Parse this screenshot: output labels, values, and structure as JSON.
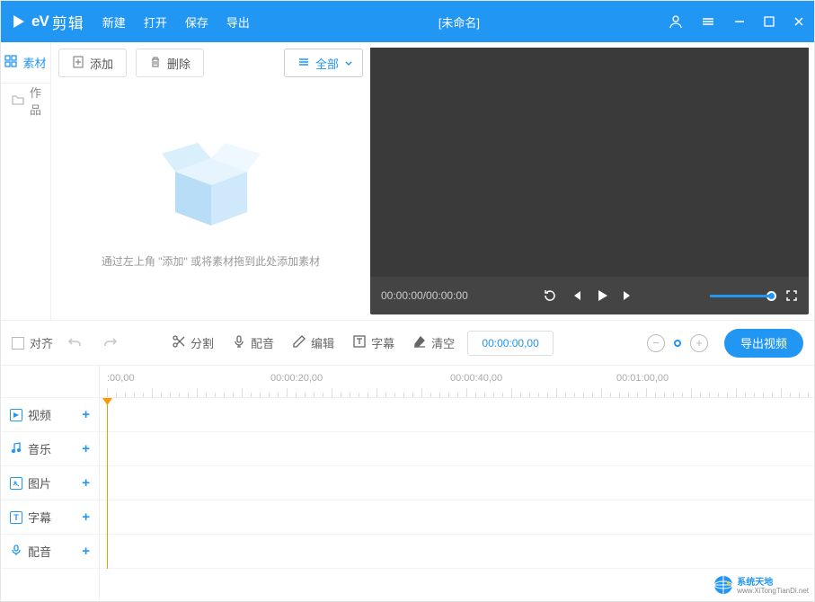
{
  "titlebar": {
    "app_name": "剪辑",
    "menu": {
      "new": "新建",
      "open": "打开",
      "save": "保存",
      "export": "导出"
    },
    "document_title": "[未命名]"
  },
  "sidebar": {
    "tab_material": "素材",
    "tab_works": "作品"
  },
  "material": {
    "add_label": "添加",
    "delete_label": "删除",
    "filter_all": "全部",
    "empty_hint": "通过左上角 \"添加\" 或将素材拖到此处添加素材"
  },
  "preview": {
    "time_display": "00:00:00/00:00:00"
  },
  "edit_toolbar": {
    "align": "对齐",
    "split": "分割",
    "voiceover": "配音",
    "edit": "编辑",
    "subtitle": "字幕",
    "clear": "清空",
    "timecode": "00:00:00,00",
    "export_video": "导出视频"
  },
  "ruler_marks": [
    {
      "label": ":00,00",
      "pos": 8
    },
    {
      "label": "00:00:20,00",
      "pos": 190
    },
    {
      "label": "00:00:40,00",
      "pos": 390
    },
    {
      "label": "00:01:00,00",
      "pos": 575
    }
  ],
  "tracks": {
    "video": "视频",
    "audio": "音乐",
    "image": "图片",
    "subtitle": "字幕",
    "voiceover": "配音"
  },
  "watermark": {
    "title": "系统天地",
    "url": "www.XiTongTianDi.net"
  }
}
